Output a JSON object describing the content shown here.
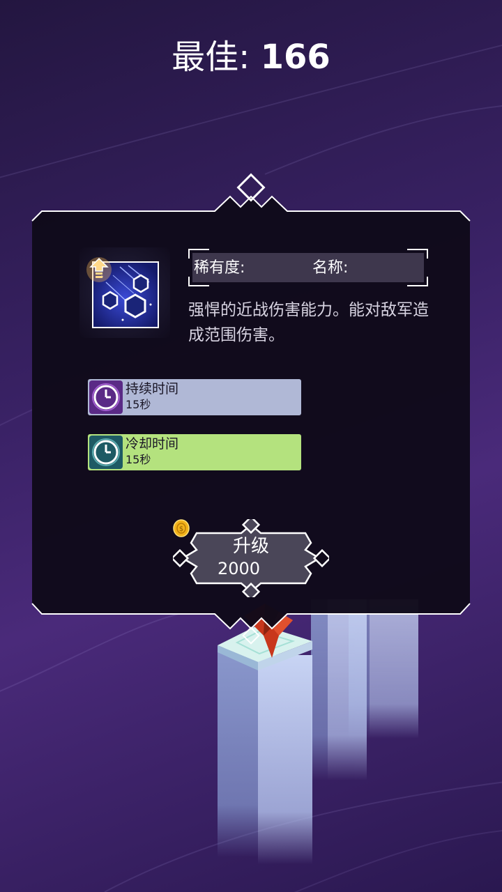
{
  "header": {
    "best_label": "最佳:",
    "best_value": "166"
  },
  "skill": {
    "icon": "ice-shards-icon",
    "rarity_label": "稀有度:",
    "name_label": "名称:",
    "description": "强悍的近战伤害能力。能对敌军造成范围伤害。"
  },
  "stats": [
    {
      "icon": "clock-icon",
      "title": "持续时间",
      "value": "15秒",
      "color": "#b0b8d6"
    },
    {
      "icon": "clock-icon",
      "title": "冷却时间",
      "value": "15秒",
      "color": "#b4e27e"
    }
  ],
  "upgrade": {
    "label": "升级",
    "cost": "2000",
    "currency_icon": "gold-coin-icon"
  },
  "colors": {
    "panel": "#100a1a",
    "frame": "#ffffff",
    "background": "#3a2266"
  }
}
